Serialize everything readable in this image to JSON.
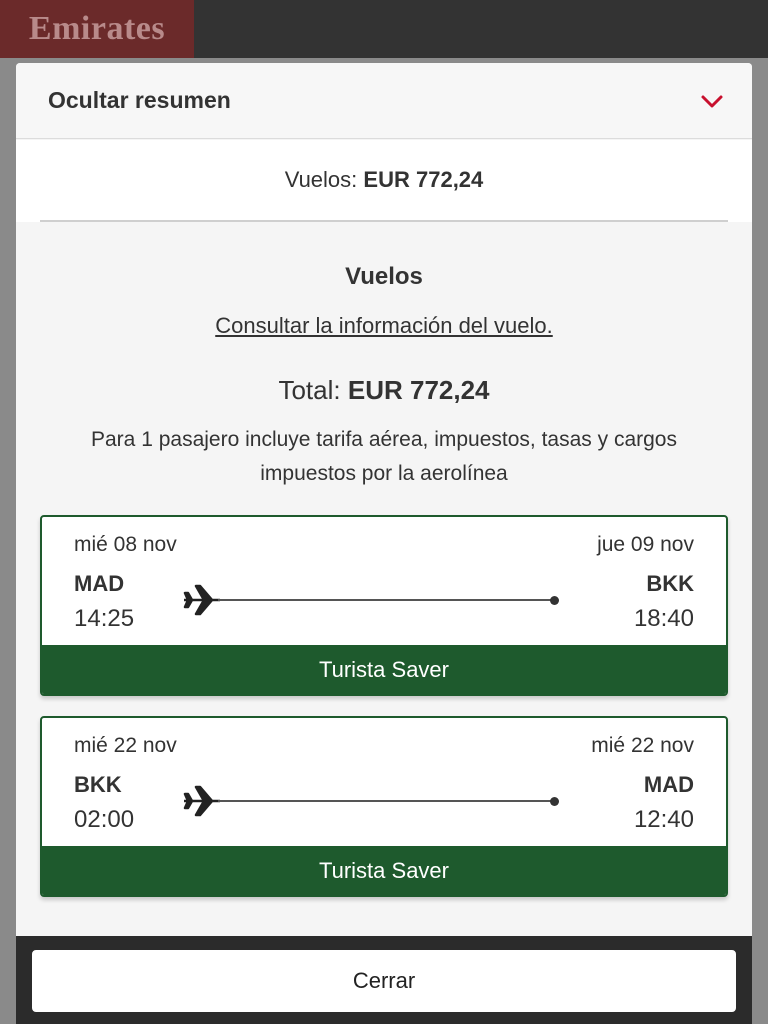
{
  "brand": {
    "logo_text": "Emirates"
  },
  "summary": {
    "header_title": "Ocultar resumen",
    "flights_label": "Vuelos:",
    "flights_amount": "EUR 772,24",
    "section_title": "Vuelos",
    "info_link": "Consultar la información del vuelo.",
    "total_label": "Total:",
    "total_amount": "EUR 772,24",
    "note": "Para 1 pasajero incluye tarifa aérea, impuestos, tasas y cargos impuestos por la aerolínea"
  },
  "flights": [
    {
      "depart_date": "mié 08 nov",
      "arrive_date": "jue 09 nov",
      "origin": "MAD",
      "destination": "BKK",
      "depart_time": "14:25",
      "arrive_time": "18:40",
      "fare": "Turista Saver"
    },
    {
      "depart_date": "mié 22 nov",
      "arrive_date": "mié 22 nov",
      "origin": "BKK",
      "destination": "MAD",
      "depart_time": "02:00",
      "arrive_time": "12:40",
      "fare": "Turista Saver"
    }
  ],
  "footer": {
    "close_label": "Cerrar"
  },
  "colors": {
    "accent_red": "#c8102e",
    "fare_green": "#1e5a2d"
  },
  "icons": {
    "header_toggle": "chevron-down-icon",
    "flight": "airplane-icon"
  }
}
